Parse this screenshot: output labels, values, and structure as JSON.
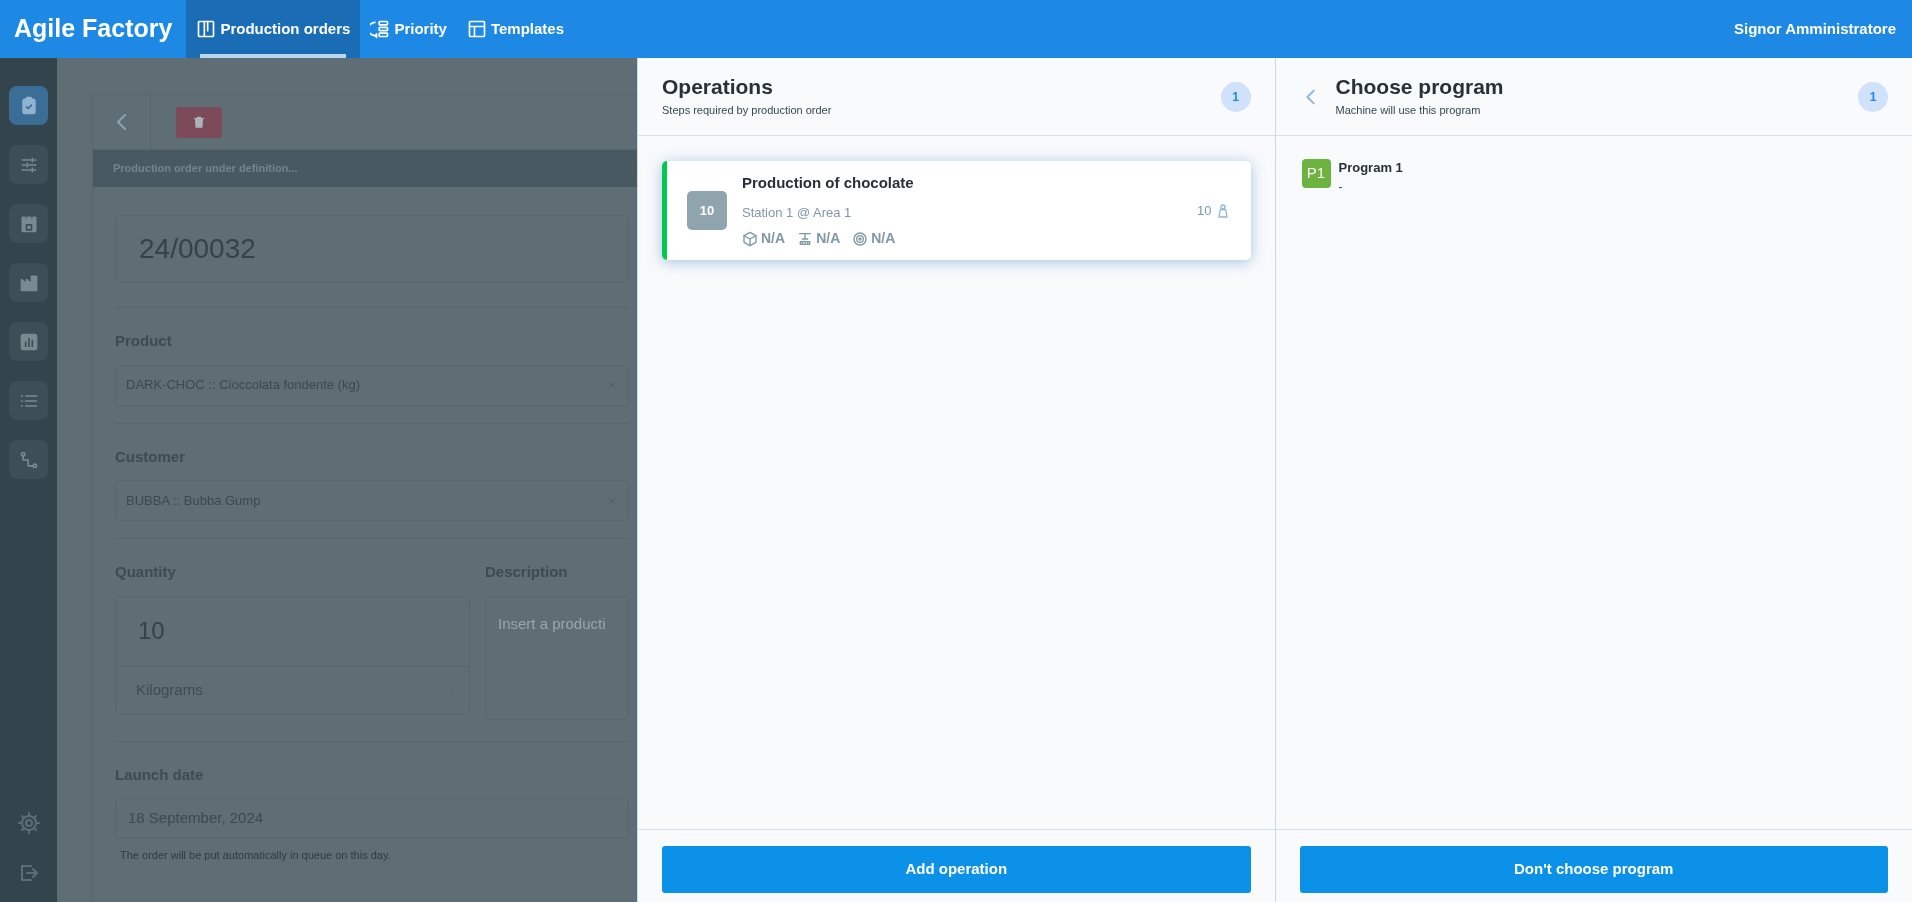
{
  "top_bar": {
    "brand": "Agile Factory",
    "tabs": [
      {
        "label": "Production orders",
        "selected": true
      },
      {
        "label": "Priority",
        "selected": false
      },
      {
        "label": "Templates",
        "selected": false
      }
    ],
    "user": "Signor Amministratore"
  },
  "sidebar": {
    "items": [
      {
        "selected": true
      },
      {
        "selected": false
      },
      {
        "selected": false
      },
      {
        "selected": false
      },
      {
        "selected": false
      },
      {
        "selected": false
      },
      {
        "selected": false
      }
    ]
  },
  "order_form": {
    "status": "Production order under definition...",
    "number": "24/00032",
    "product": {
      "label": "Product",
      "value": "DARK-CHOC :: Cioccolata fondente (kg)"
    },
    "customer": {
      "label": "Customer",
      "value": "BUBBA :: Bubba Gump"
    },
    "quantity": {
      "label": "Quantity",
      "value": "10",
      "unit": "Kilograms"
    },
    "description": {
      "label": "Description",
      "placeholder": "Insert a producti"
    },
    "launch_date": {
      "label": "Launch date",
      "value": "18 September, 2024",
      "hint": "The order will be put automatically in queue on this day."
    }
  },
  "operations_panel": {
    "title": "Operations",
    "subtitle": "Steps required by production order",
    "count": "1",
    "operations": [
      {
        "number": "10",
        "name": "Production of chocolate",
        "station": "Station 1 @ Area 1",
        "quantity": "10",
        "color": "#00c853",
        "stats": [
          "N/A",
          "N/A",
          "N/A"
        ]
      }
    ],
    "button": "Add operation"
  },
  "program_panel": {
    "title": "Choose program",
    "subtitle": "Machine will use this program",
    "count": "1",
    "programs": [
      {
        "badge": "P1",
        "name": "Program 1",
        "detail": "-",
        "color": "#6db33f"
      }
    ],
    "button": "Don't choose program"
  }
}
